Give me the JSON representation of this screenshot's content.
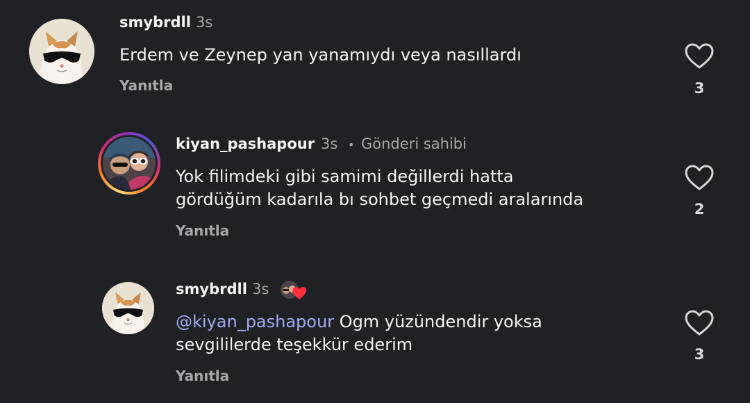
{
  "comments": [
    {
      "username": "smybrdll",
      "time": "3s",
      "text": "Erdem ve Zeynep yan yanamıydı veya nasıllardı",
      "reply_label": "Yanıtla",
      "likes": "3",
      "avatar_icon": "cat-with-sunglasses"
    },
    {
      "username": "kiyan_pashapour",
      "time": "3s",
      "separator": "•",
      "author_tag": "Gönderi sahibi",
      "text_line1": "Yok filimdeki gibi samimi değillerdi hatta",
      "text_line2": "gördüğüm kadarıla bı sohbet geçmedi aralarında",
      "reply_label": "Yanıtla",
      "likes": "2",
      "avatar_icon": "selfie-photo-with-story-ring"
    },
    {
      "username": "smybrdll",
      "time": "3s",
      "mention": "@kiyan_pashapour",
      "text_line1_rest": " Ogm yüzündendir yoksa",
      "text_line2": "sevgililerde teşekkür ederim",
      "reply_label": "Yanıtla",
      "likes": "3",
      "avatar_icon": "cat-with-sunglasses",
      "liked_by_icon": "author-avatar-with-heart"
    }
  ],
  "colors": {
    "background": "#202125",
    "primary_text": "#f5f5f5",
    "secondary_text": "#a8a8a8",
    "mention": "#a3a9f5"
  }
}
